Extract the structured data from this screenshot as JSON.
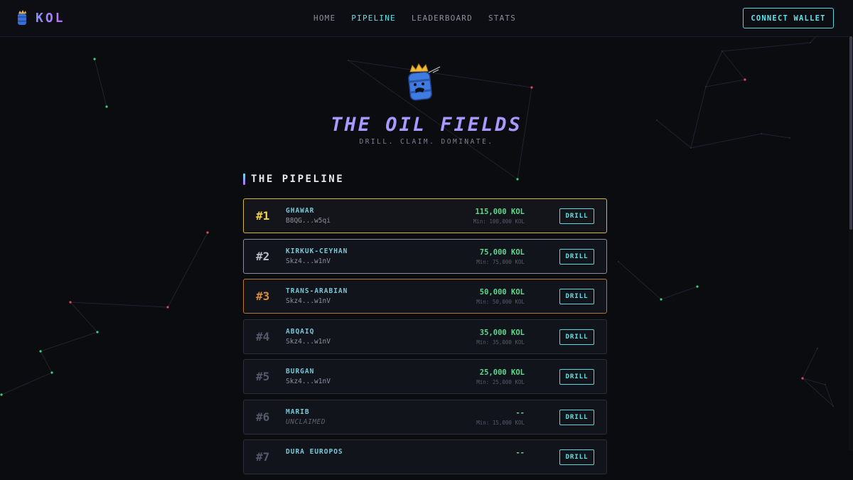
{
  "header": {
    "logo_text": "KOL",
    "nav": [
      {
        "label": "HOME",
        "active": false
      },
      {
        "label": "PIPELINE",
        "active": true
      },
      {
        "label": "LEADERBOARD",
        "active": false
      },
      {
        "label": "STATS",
        "active": false
      }
    ],
    "wallet_button": "CONNECT WALLET"
  },
  "hero": {
    "title": "THE OIL FIELDS",
    "subtitle": "DRILL. CLAIM. DOMINATE."
  },
  "section": {
    "title": "THE PIPELINE"
  },
  "pipeline": [
    {
      "rank": "#1",
      "name": "GHAWAR",
      "owner": "B8QG...w5qi",
      "amount": "115,000 KOL",
      "min": "Min: 100,000 KOL",
      "action": "DRILL",
      "tier": "gold"
    },
    {
      "rank": "#2",
      "name": "KIRKUK-CEYHAN",
      "owner": "Skz4...w1nV",
      "amount": "75,000 KOL",
      "min": "Min: 75,000 KOL",
      "action": "DRILL",
      "tier": "silver"
    },
    {
      "rank": "#3",
      "name": "TRANS-ARABIAN",
      "owner": "Skz4...w1nV",
      "amount": "50,000 KOL",
      "min": "Min: 50,000 KOL",
      "action": "DRILL",
      "tier": "bronze"
    },
    {
      "rank": "#4",
      "name": "ABQAIQ",
      "owner": "Skz4...w1nV",
      "amount": "35,000 KOL",
      "min": "Min: 35,000 KOL",
      "action": "DRILL",
      "tier": "normal"
    },
    {
      "rank": "#5",
      "name": "BURGAN",
      "owner": "Skz4...w1nV",
      "amount": "25,000 KOL",
      "min": "Min: 25,000 KOL",
      "action": "DRILL",
      "tier": "normal"
    },
    {
      "rank": "#6",
      "name": "MARIB",
      "owner": "UNCLAIMED",
      "amount": "--",
      "min": "Min: 15,000 KOL",
      "action": "DRILL",
      "tier": "normal",
      "unclaimed": true
    },
    {
      "rank": "#7",
      "name": "DURA EUROPOS",
      "owner": "",
      "amount": "--",
      "min": "",
      "action": "DRILL",
      "tier": "normal",
      "unclaimed": true
    }
  ],
  "colors": {
    "accent": "#5fe3e6",
    "gold": "#f0cf3c",
    "silver": "#b8bcc5",
    "bronze": "#d9893a",
    "amount": "#5fd88d",
    "background": "#0b0c10"
  },
  "icons": {
    "logo": "oil-barrel-icon",
    "mascot": "crowned-oil-barrel-icon"
  }
}
